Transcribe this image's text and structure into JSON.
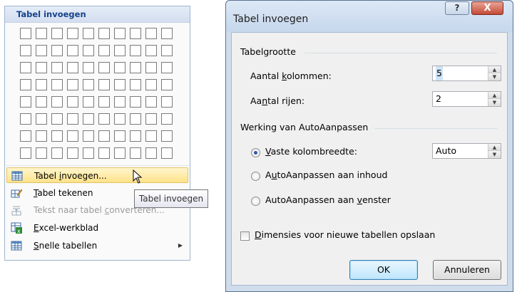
{
  "menu": {
    "header": "Tabel invoegen",
    "grid": {
      "columns": 10,
      "rows": 8
    },
    "items": [
      {
        "label_pre": "Tabel ",
        "label_u": "i",
        "label_post": "nvoegen...",
        "icon": "table-insert-icon",
        "state": "highlighted"
      },
      {
        "label_pre": "",
        "label_u": "T",
        "label_post": "abel tekenen",
        "icon": "pencil-table-icon",
        "state": "normal"
      },
      {
        "label_pre": "Tekst naar tabel ",
        "label_u": "c",
        "label_post": "onverteren...",
        "icon": "text-to-table-icon",
        "state": "disabled"
      },
      {
        "label_pre": "",
        "label_u": "E",
        "label_post": "xcel-werkblad",
        "icon": "excel-icon",
        "state": "normal"
      },
      {
        "label_pre": "",
        "label_u": "S",
        "label_post": "nelle tabellen",
        "icon": "quick-tables-icon",
        "state": "normal",
        "submenu": true
      }
    ]
  },
  "tooltip": "Tabel invoegen",
  "dialog": {
    "title": "Tabel invoegen",
    "help_label": "?",
    "close_label": "X",
    "size_group": "Tabelgrootte",
    "columns_label": {
      "pre": "Aantal ",
      "u": "k",
      "post": "olommen:"
    },
    "columns_value": "5",
    "rows_label": {
      "pre": "Aa",
      "u": "n",
      "post": "tal rijen:"
    },
    "rows_value": "2",
    "autofit_group": "Werking van AutoAanpassen",
    "opt_fixed": {
      "pre": "",
      "u": "V",
      "post": "aste kolombreedte:"
    },
    "fixed_value": "Auto",
    "opt_content": {
      "pre": "A",
      "u": "u",
      "post": "toAanpassen aan inhoud"
    },
    "opt_window": {
      "pre": "AutoAanpassen aan ",
      "u": "v",
      "post": "enster"
    },
    "remember": {
      "pre": "",
      "u": "D",
      "post": "imensies voor nieuwe tabellen opslaan"
    },
    "ok_label": "OK",
    "cancel_label": "Annuleren"
  }
}
